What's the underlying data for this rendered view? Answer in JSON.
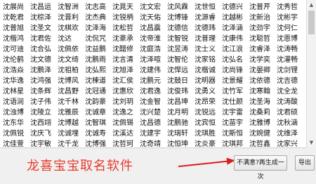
{
  "names_grid": {
    "rows": [
      [
        "沈展尚",
        "沈昌运",
        "沈智洲",
        "沈志高",
        "沈晁天",
        "沈文宏",
        "沈风霖",
        "沈世恒",
        "沈德兴",
        "沈普芹",
        "沈秀哲",
        "沈乾君",
        "沈棕泽"
      ],
      [
        "沈晋利",
        "沈杰典",
        "沈锐柄",
        "沈天佑",
        "沈博锋",
        "沈源睿",
        "沈越彬",
        "沈新治",
        "沈彬宇",
        "沈普旭",
        "沈圣文",
        "沈棋欢",
        "沈泽海"
      ],
      [
        "沈松哲",
        "沈昌震",
        "沈德信",
        "沈德玮",
        "沈泽涵",
        "沈劲宇",
        "沈何仁",
        "沈楷鸿",
        "沈君佐",
        "沈达",
        "沈侃咒",
        "沈豪承",
        "沈帝淮"
      ],
      [
        "沈智锐",
        "沈普理",
        "沈康伟",
        "沈聪哲",
        "沈恩博",
        "沈可迪",
        "沈合弘",
        "沈佩依",
        "沈益鹏",
        "沈醋修",
        "沈庭浩",
        "沈昱涛",
        "沈士义"
      ],
      [
        "沈江浪",
        "沈睿泽",
        "沈涛畅",
        "沈伦鹤",
        "沈文德",
        "沈文绮",
        "沈鹏雨",
        "沈言清",
        "沈泽喧",
        "沈智伦",
        "沈家铭",
        "沈弘名",
        "沈学奕"
      ],
      [
        "沈灌畅",
        "沈浩焱",
        "沈鹏泽",
        "沈祖柏",
        "沈弘熙",
        "沈旭泽",
        "沈建伟",
        "沈悍远",
        "沈楷诚",
        "沈尚锋",
        "沈晏卿",
        "沈剑锂",
        "沈华逸"
      ],
      [
        "沈鸿强",
        "沈博风",
        "沈楝道",
        "沈汇侯",
        "沈鹏元",
        "沈鼓日",
        "沈明器",
        "沈景耀",
        "沈依德",
        "沈吉德",
        "沈林星",
        "沈条辉",
        "沈昌野"
      ],
      [
        "沈冠通",
        "沈惠欣",
        "沈君逸",
        "沈俊玮",
        "沈勇义",
        "沈竹军",
        "沈寒翰",
        "沈全龙",
        "沈语润",
        "沈子伟",
        "沈千林",
        "沈韵豪",
        "沈刘玥"
      ],
      [
        "沈金智",
        "沈昌坤",
        "沈昂荣",
        "沈仕颜",
        "沈圣海",
        "沈涛酸",
        "沈浊博",
        "沈陵立",
        "沈雅辰",
        "沈诚章",
        "沈逸之",
        "沈兴楚",
        "沈月明"
      ],
      [
        "沈锐远",
        "沈宇雷",
        "沈桑莉",
        "沈君硕",
        "沈东华",
        "沈西翊",
        "沈博越",
        "沈智琪",
        "沈佩锡",
        "沈昌德",
        "沈鹏驰",
        "沈宾恒",
        "沈苗宇"
      ],
      [
        "沈雅博",
        "沈秋涵",
        "沈佩锐",
        "沈庆飞",
        "沈诚埋",
        "沈诚寿",
        "沈溪达",
        "沈建宇",
        "沈瑞轩",
        "沈琪胜",
        "沈斯恒",
        "沈婉健",
        "沈维泽"
      ],
      [
        "沈佳萱",
        "沈宇敏",
        "沈千龙",
        "沈博强",
        "沈哲珂",
        "沈奇靖",
        "沈恒坤",
        "沈炎豪",
        "沈琪邦",
        "沈哲鑫",
        "沈家兴",
        "沈懿靖",
        "沈新涛"
      ],
      [
        "沈宇翰",
        "沈佳宇",
        "沈月朗",
        "沈丽德",
        "沈家辉",
        "沈敏珂",
        "沈明德",
        "沈智源",
        "沈昌熙",
        "沈明娴",
        "沈智铭",
        "沈书浩",
        "沈飞辉"
      ]
    ]
  },
  "buttons": {
    "regenerate": "不满意?再生成一次",
    "export": "导出"
  },
  "caption": "龙喜宝宝取名软件",
  "colors": {
    "caption": "#e83a2b",
    "arrow": "#d81e1e"
  }
}
